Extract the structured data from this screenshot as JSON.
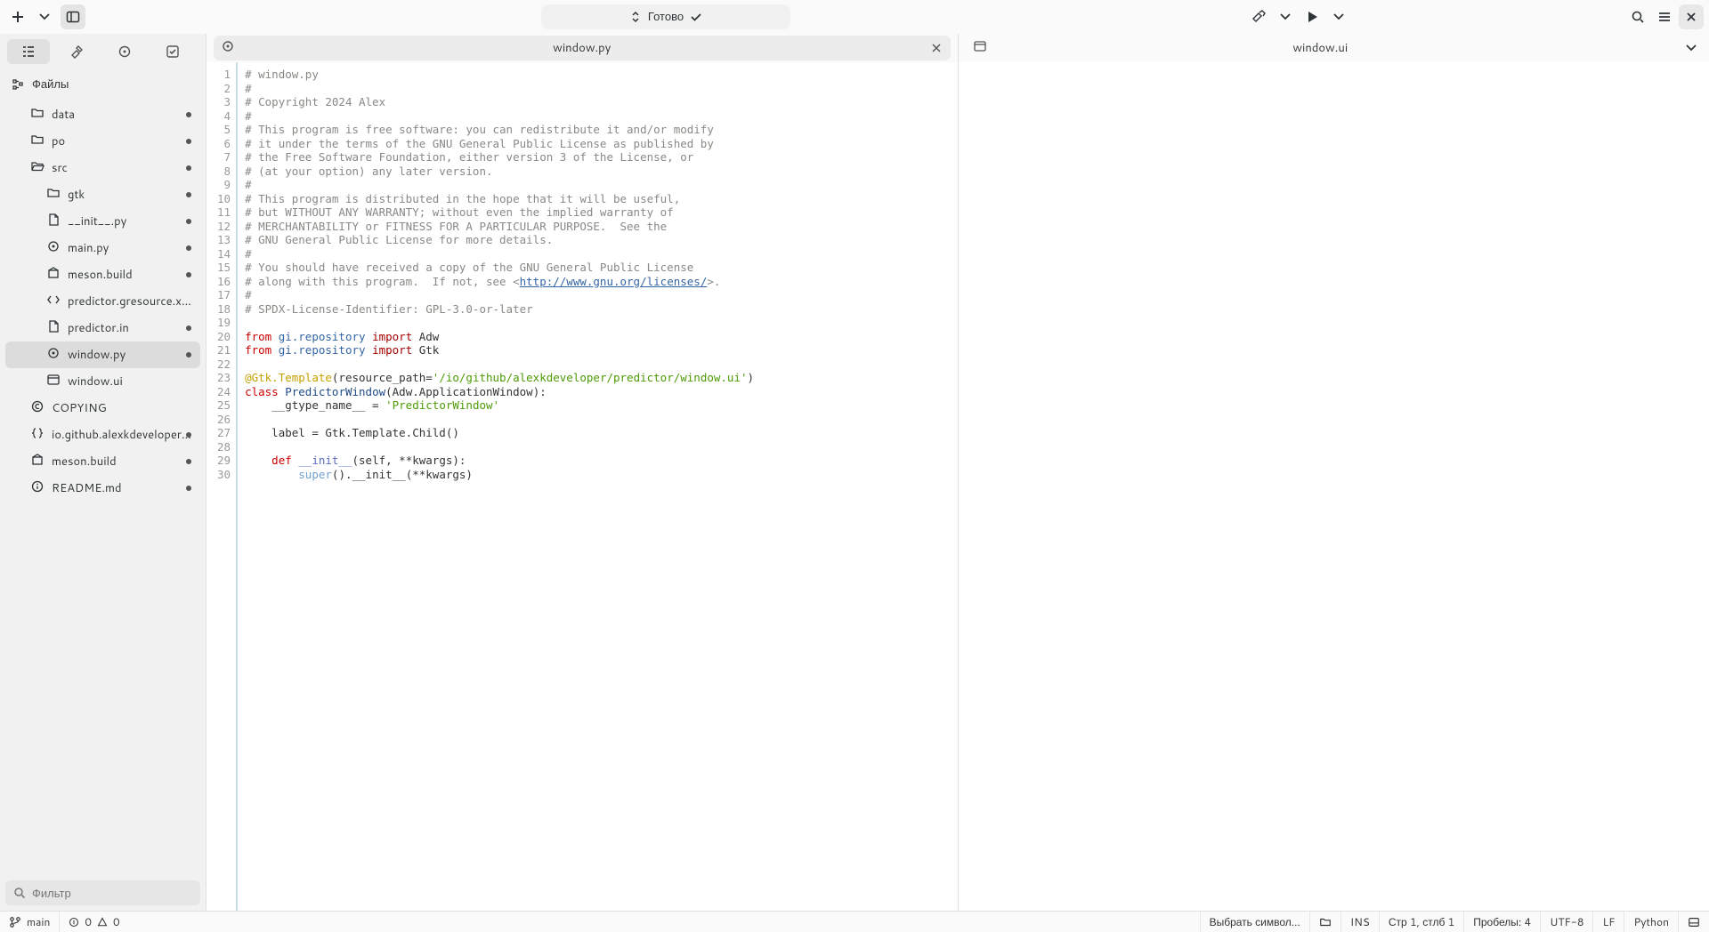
{
  "toolbar": {
    "status_label": "Готово",
    "status_icon": "check"
  },
  "side_tabs": [
    "files",
    "build",
    "globe",
    "todo"
  ],
  "files_header": "Файлы",
  "filter_placeholder": "Фильтр",
  "tree": [
    {
      "depth": 1,
      "icon": "folder",
      "label": "data",
      "dot": true
    },
    {
      "depth": 1,
      "icon": "folder",
      "label": "po",
      "dot": true
    },
    {
      "depth": 1,
      "icon": "folder-open",
      "label": "src",
      "dot": true
    },
    {
      "depth": 2,
      "icon": "folder",
      "label": "gtk",
      "dot": true
    },
    {
      "depth": 2,
      "icon": "file",
      "label": "__init__.py",
      "dot": true
    },
    {
      "depth": 2,
      "icon": "python",
      "label": "main.py",
      "dot": true
    },
    {
      "depth": 2,
      "icon": "meson",
      "label": "meson.build",
      "dot": true
    },
    {
      "depth": 2,
      "icon": "xml",
      "label": "predictor.gresource.xml",
      "dot": false
    },
    {
      "depth": 2,
      "icon": "file",
      "label": "predictor.in",
      "dot": true
    },
    {
      "depth": 2,
      "icon": "python",
      "label": "window.py",
      "dot": true,
      "selected": true
    },
    {
      "depth": 2,
      "icon": "ui",
      "label": "window.ui",
      "dot": false
    },
    {
      "depth": 1,
      "icon": "license",
      "label": "COPYING",
      "dot": false
    },
    {
      "depth": 1,
      "icon": "json",
      "label": "io.github.alexkdeveloper.pre…",
      "dot": true
    },
    {
      "depth": 1,
      "icon": "meson",
      "label": "meson.build",
      "dot": true
    },
    {
      "depth": 1,
      "icon": "readme",
      "label": "README.md",
      "dot": true
    }
  ],
  "left_tab": {
    "label": "window.py"
  },
  "right_tab": {
    "label": "window.ui"
  },
  "code_lines": [
    [
      {
        "t": "# window.py",
        "c": "c-comment"
      }
    ],
    [
      {
        "t": "#",
        "c": "c-comment"
      }
    ],
    [
      {
        "t": "# Copyright 2024 Alex",
        "c": "c-comment"
      }
    ],
    [
      {
        "t": "#",
        "c": "c-comment"
      }
    ],
    [
      {
        "t": "# This program is free software: you can redistribute it and/or modify",
        "c": "c-comment"
      }
    ],
    [
      {
        "t": "# it under the terms of the GNU General Public License as published by",
        "c": "c-comment"
      }
    ],
    [
      {
        "t": "# the Free Software Foundation, either version 3 of the License, or",
        "c": "c-comment"
      }
    ],
    [
      {
        "t": "# (at your option) any later version.",
        "c": "c-comment"
      }
    ],
    [
      {
        "t": "#",
        "c": "c-comment"
      }
    ],
    [
      {
        "t": "# This program is distributed in the hope that it will be useful,",
        "c": "c-comment"
      }
    ],
    [
      {
        "t": "# but WITHOUT ANY WARRANTY; without even the implied warranty of",
        "c": "c-comment"
      }
    ],
    [
      {
        "t": "# MERCHANTABILITY or FITNESS FOR A PARTICULAR PURPOSE.  See the",
        "c": "c-comment"
      }
    ],
    [
      {
        "t": "# GNU General Public License for more details.",
        "c": "c-comment"
      }
    ],
    [
      {
        "t": "#",
        "c": "c-comment"
      }
    ],
    [
      {
        "t": "# You should have received a copy of the GNU General Public License",
        "c": "c-comment"
      }
    ],
    [
      {
        "t": "# along with this program.  If not, see <",
        "c": "c-comment"
      },
      {
        "t": "http://www.gnu.org/licenses/",
        "c": "c-link"
      },
      {
        "t": ">.",
        "c": "c-comment"
      }
    ],
    [
      {
        "t": "#",
        "c": "c-comment"
      }
    ],
    [
      {
        "t": "# SPDX-License-Identifier: GPL-3.0-or-later",
        "c": "c-comment"
      }
    ],
    [],
    [
      {
        "t": "from",
        "c": "c-keyword"
      },
      {
        "t": " "
      },
      {
        "t": "gi.repository",
        "c": "c-module"
      },
      {
        "t": " "
      },
      {
        "t": "import",
        "c": "c-import"
      },
      {
        "t": " Adw"
      }
    ],
    [
      {
        "t": "from",
        "c": "c-keyword"
      },
      {
        "t": " "
      },
      {
        "t": "gi.repository",
        "c": "c-module"
      },
      {
        "t": " "
      },
      {
        "t": "import",
        "c": "c-import"
      },
      {
        "t": " Gtk"
      }
    ],
    [],
    [
      {
        "t": "@Gtk.Template",
        "c": "c-decorator"
      },
      {
        "t": "(resource_path="
      },
      {
        "t": "'/io/github/alexkdeveloper/predictor/window.ui'",
        "c": "c-string"
      },
      {
        "t": ")"
      }
    ],
    [
      {
        "t": "class",
        "c": "c-keyword"
      },
      {
        "t": " "
      },
      {
        "t": "PredictorWindow",
        "c": "c-class"
      },
      {
        "t": "(Adw.ApplicationWindow):"
      }
    ],
    [
      {
        "t": "    __gtype_name__ = "
      },
      {
        "t": "'PredictorWindow'",
        "c": "c-string"
      }
    ],
    [],
    [
      {
        "t": "    label = Gtk.Template.Child()"
      }
    ],
    [],
    [
      {
        "t": "    "
      },
      {
        "t": "def",
        "c": "c-keyword"
      },
      {
        "t": " "
      },
      {
        "t": "__init__",
        "c": "c-func"
      },
      {
        "t": "(self, **kwargs):"
      }
    ],
    [
      {
        "t": "        "
      },
      {
        "t": "super",
        "c": "c-builtin"
      },
      {
        "t": "().__init__(**kwargs)"
      }
    ]
  ],
  "statusbar": {
    "branch": "main",
    "errors": "0",
    "warnings": "0",
    "symbol": "Выбрать символ…",
    "ins": "INS",
    "position": "Стр 1, стлб 1",
    "spaces": "Пробелы: 4",
    "encoding": "UTF-8",
    "eol": "LF",
    "language": "Python"
  }
}
